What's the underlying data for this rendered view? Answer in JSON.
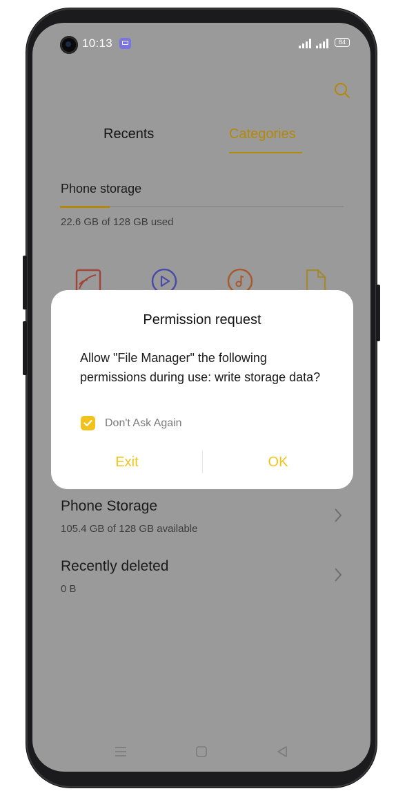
{
  "status_bar": {
    "time": "10:13",
    "battery": "84"
  },
  "tabs": [
    {
      "label": "Recents"
    },
    {
      "label": "Categories"
    }
  ],
  "storage": {
    "title": "Phone storage",
    "usage": "22.6 GB of 128 GB used",
    "used_fraction": 0.177
  },
  "categories": [
    {
      "icon": "image-icon"
    },
    {
      "icon": "video-icon"
    },
    {
      "icon": "music-icon"
    },
    {
      "icon": "document-icon"
    }
  ],
  "list": [
    {
      "title": "Phone Storage",
      "subtitle": "105.4 GB of 128 GB available"
    },
    {
      "title": "Recently deleted",
      "subtitle": "0 B"
    }
  ],
  "dialog": {
    "title": "Permission request",
    "message": "Allow \"File Manager\" the following permissions during use: write storage data?",
    "checkbox_label": "Don't Ask Again",
    "checkbox_checked": true,
    "exit_label": "Exit",
    "ok_label": "OK"
  },
  "colors": {
    "accent": "#f2c21c",
    "accent_dim": "#b4890b",
    "scrim": "#9a9a9a",
    "dialog_bg": "#ffffff"
  }
}
